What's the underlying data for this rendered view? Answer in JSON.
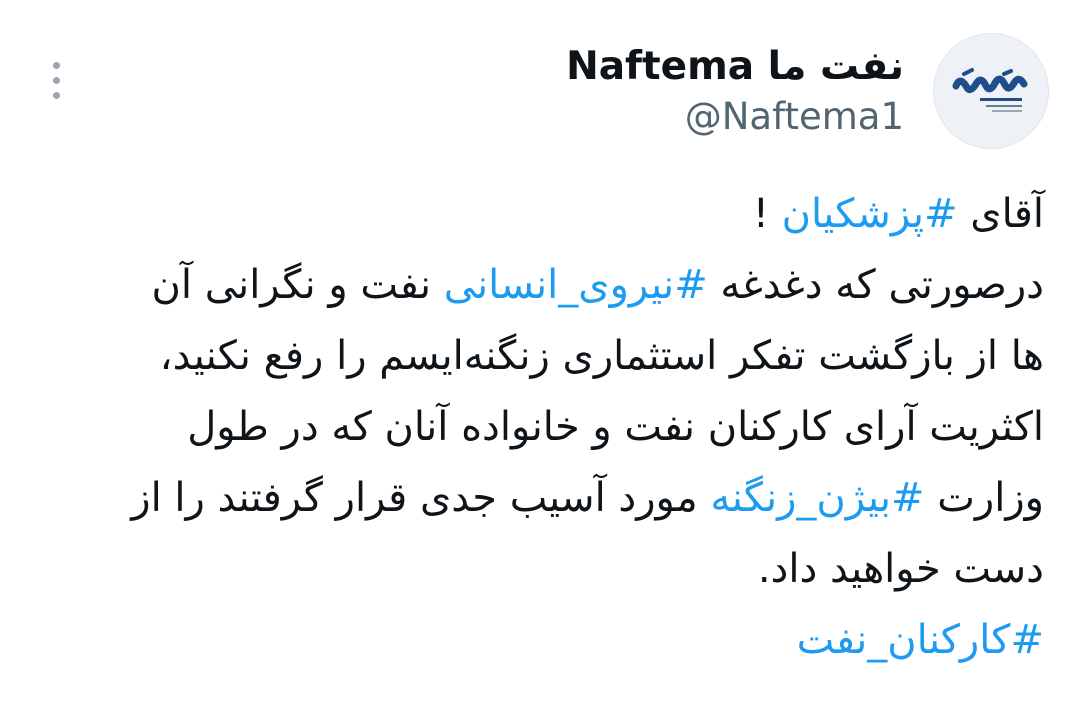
{
  "header": {
    "display_name": "نفت ما Naftema",
    "handle": "@Naftema1",
    "avatar_icon": "naftema-logo-avatar",
    "more_icon": "more-vertical-icon"
  },
  "tweet": {
    "line1": {
      "pre": "آقای ",
      "hashtag": "#پزشکیان",
      "post": " !"
    },
    "line2": {
      "pre": "درصورتی که دغدغه ",
      "hashtag": "#نیروی_انسانی",
      "post": " نفت و نگرانی آن"
    },
    "line3": "ها از بازگشت تفکر استثماری زنگنه‌ایسم را رفع نکنید،",
    "line4": "اکثریت آرای کارکنان نفت و خانواده آنان که در طول",
    "line5": {
      "pre": "وزارت ",
      "hashtag": "#بیژن_زنگنه",
      "post": " مورد آسیب جدی قرار گرفتند را از"
    },
    "line6": "دست خواهید داد.",
    "line7": {
      "hashtag": "#کارکنان_نفت"
    }
  },
  "colors": {
    "hashtag": "#1d9bf0",
    "text": "#0f1419",
    "muted": "#536471"
  }
}
